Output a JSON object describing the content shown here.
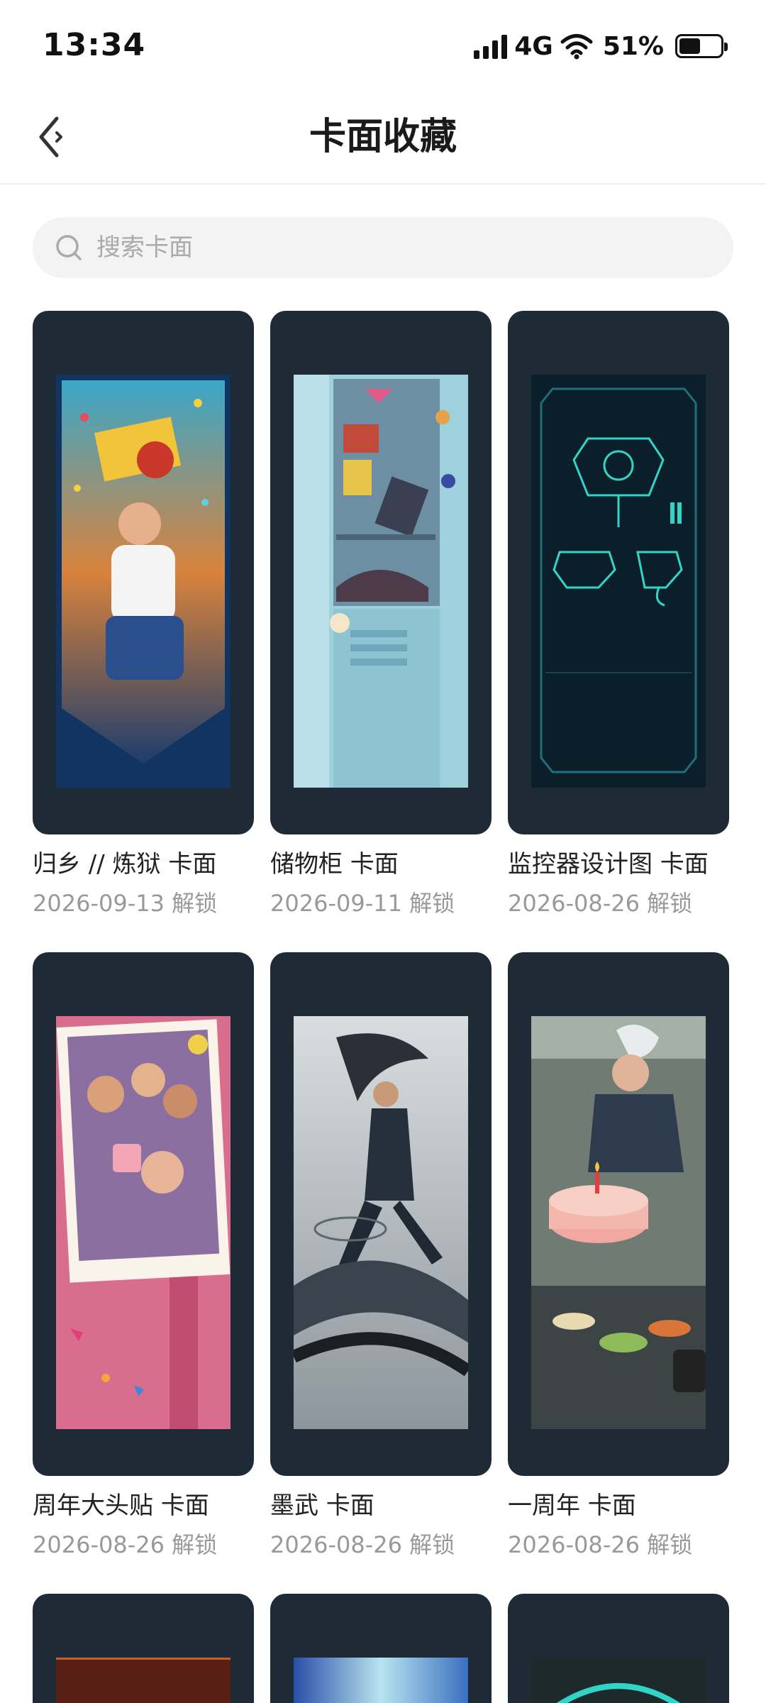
{
  "status": {
    "time": "13:34",
    "network": "4G",
    "battery": "51%",
    "battery_level": 0.51
  },
  "header": {
    "title": "卡面收藏",
    "back_icon": "back-arrow-icon"
  },
  "search": {
    "placeholder": "搜索卡面",
    "icon": "search-icon"
  },
  "cards": [
    {
      "title": "归乡 // 炼狱 卡面",
      "date": "2026-09-13 解锁",
      "art": "banner-hero-celebration"
    },
    {
      "title": "储物柜 卡面",
      "date": "2026-09-11 解锁",
      "art": "locker"
    },
    {
      "title": "监控器设计图 卡面",
      "date": "2026-08-26 解锁",
      "art": "blueprint"
    },
    {
      "title": "周年大头贴 卡面",
      "date": "2026-08-26 解锁",
      "art": "anniversary-photo"
    },
    {
      "title": "墨武 卡面",
      "date": "2026-08-26 解锁",
      "art": "ink-martial"
    },
    {
      "title": "一周年 卡面",
      "date": "2026-08-26 解锁",
      "art": "birthday-cake"
    }
  ]
}
